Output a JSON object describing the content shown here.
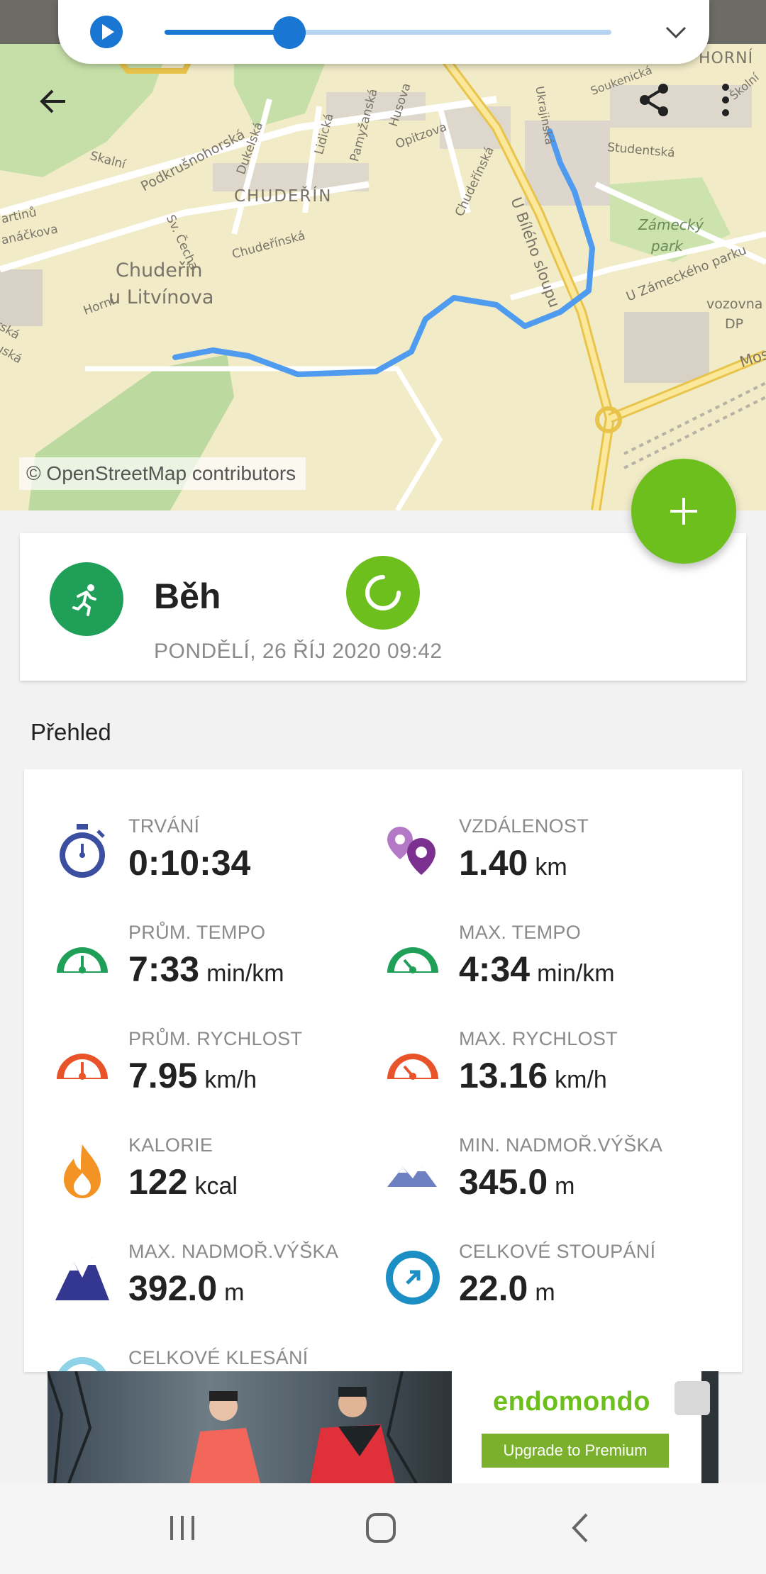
{
  "map": {
    "credit": "© OpenStreetMap contributors",
    "labels": {
      "chuderin": "CHUDEŘÍN",
      "district_line1": "Chudeřín",
      "district_line2": "u Litvínova",
      "podkrusnohorska": "Podkrušnohorská",
      "skalni": "Skalní",
      "dukelska": "Dukelská",
      "lidicka": "Lidická",
      "pamyzanska": "Pamyžanská",
      "husova": "Husova",
      "opitzova": "Opitzova",
      "chuderinska": "Chudeřínská",
      "chuderinska2": "Chudeřínská",
      "sv_cecha": "Sv. Čecha",
      "horni": "Horní",
      "u_bileho_sloupu": "U Bílého sloupu",
      "ukrajinska": "Ukrajinská",
      "soukenicka": "Soukenická",
      "studentska": "Studentská",
      "zamecky_park_1": "Zámecký",
      "zamecky_park_2": "park",
      "u_zameckeho_parku": "U Zámeckého parku",
      "vozovna_1": "vozovna",
      "vozovna_2": "DP",
      "horni_litvinov": "HORNÍ",
      "mos": "Mos",
      "skolni": "Školní",
      "martinu": "artinů",
      "janackova": "anáčkova",
      "ruska": "rská",
      "ruska2": "uská"
    }
  },
  "media": {
    "progress": 0.28
  },
  "icons": {
    "back": "arrow-left-icon",
    "share": "share-icon",
    "more": "more-vertical-icon",
    "fab": "plus-icon",
    "sport": "running-icon",
    "sync": "sync-spinner-icon"
  },
  "workout": {
    "sport": "Běh",
    "datetime": "PONDĚLÍ, 26 ŘÍJ 2020 09:42"
  },
  "overview": {
    "title": "Přehled",
    "stats": [
      {
        "label": "TRVÁNÍ",
        "value": "0:10:34",
        "unit": "",
        "icon": "stopwatch-icon"
      },
      {
        "label": "VZDÁLENOST",
        "value": "1.40",
        "unit": "km",
        "icon": "distance-pins-icon"
      },
      {
        "label": "PRŮM. TEMPO",
        "value": "7:33",
        "unit": "min/km",
        "icon": "avg-pace-gauge-icon"
      },
      {
        "label": "MAX. TEMPO",
        "value": "4:34",
        "unit": "min/km",
        "icon": "max-pace-gauge-icon"
      },
      {
        "label": "PRŮM. RYCHLOST",
        "value": "7.95",
        "unit": "km/h",
        "icon": "avg-speed-gauge-icon"
      },
      {
        "label": "MAX. RYCHLOST",
        "value": "13.16",
        "unit": "km/h",
        "icon": "max-speed-gauge-icon"
      },
      {
        "label": "KALORIE",
        "value": "122",
        "unit": "kcal",
        "icon": "flame-icon"
      },
      {
        "label": "MIN. NADMOŘ.VÝŠKA",
        "value": "345.0",
        "unit": "m",
        "icon": "low-mountains-icon"
      },
      {
        "label": "MAX. NADMOŘ.VÝŠKA",
        "value": "392.0",
        "unit": "m",
        "icon": "high-mountains-icon"
      },
      {
        "label": "CELKOVÉ STOUPÁNÍ",
        "value": "22.0",
        "unit": "m",
        "icon": "ascent-arrow-icon"
      },
      {
        "label": "CELKOVÉ KLESÁNÍ",
        "value": "",
        "unit": "",
        "icon": "descent-arrow-icon"
      }
    ]
  },
  "ad": {
    "brand": "endomondo",
    "cta": "Upgrade to Premium"
  },
  "colors": {
    "green": "#6cbf1c",
    "sport_green": "#1f9f57",
    "route_blue": "#4f9bef",
    "blue": "#1976d2"
  }
}
